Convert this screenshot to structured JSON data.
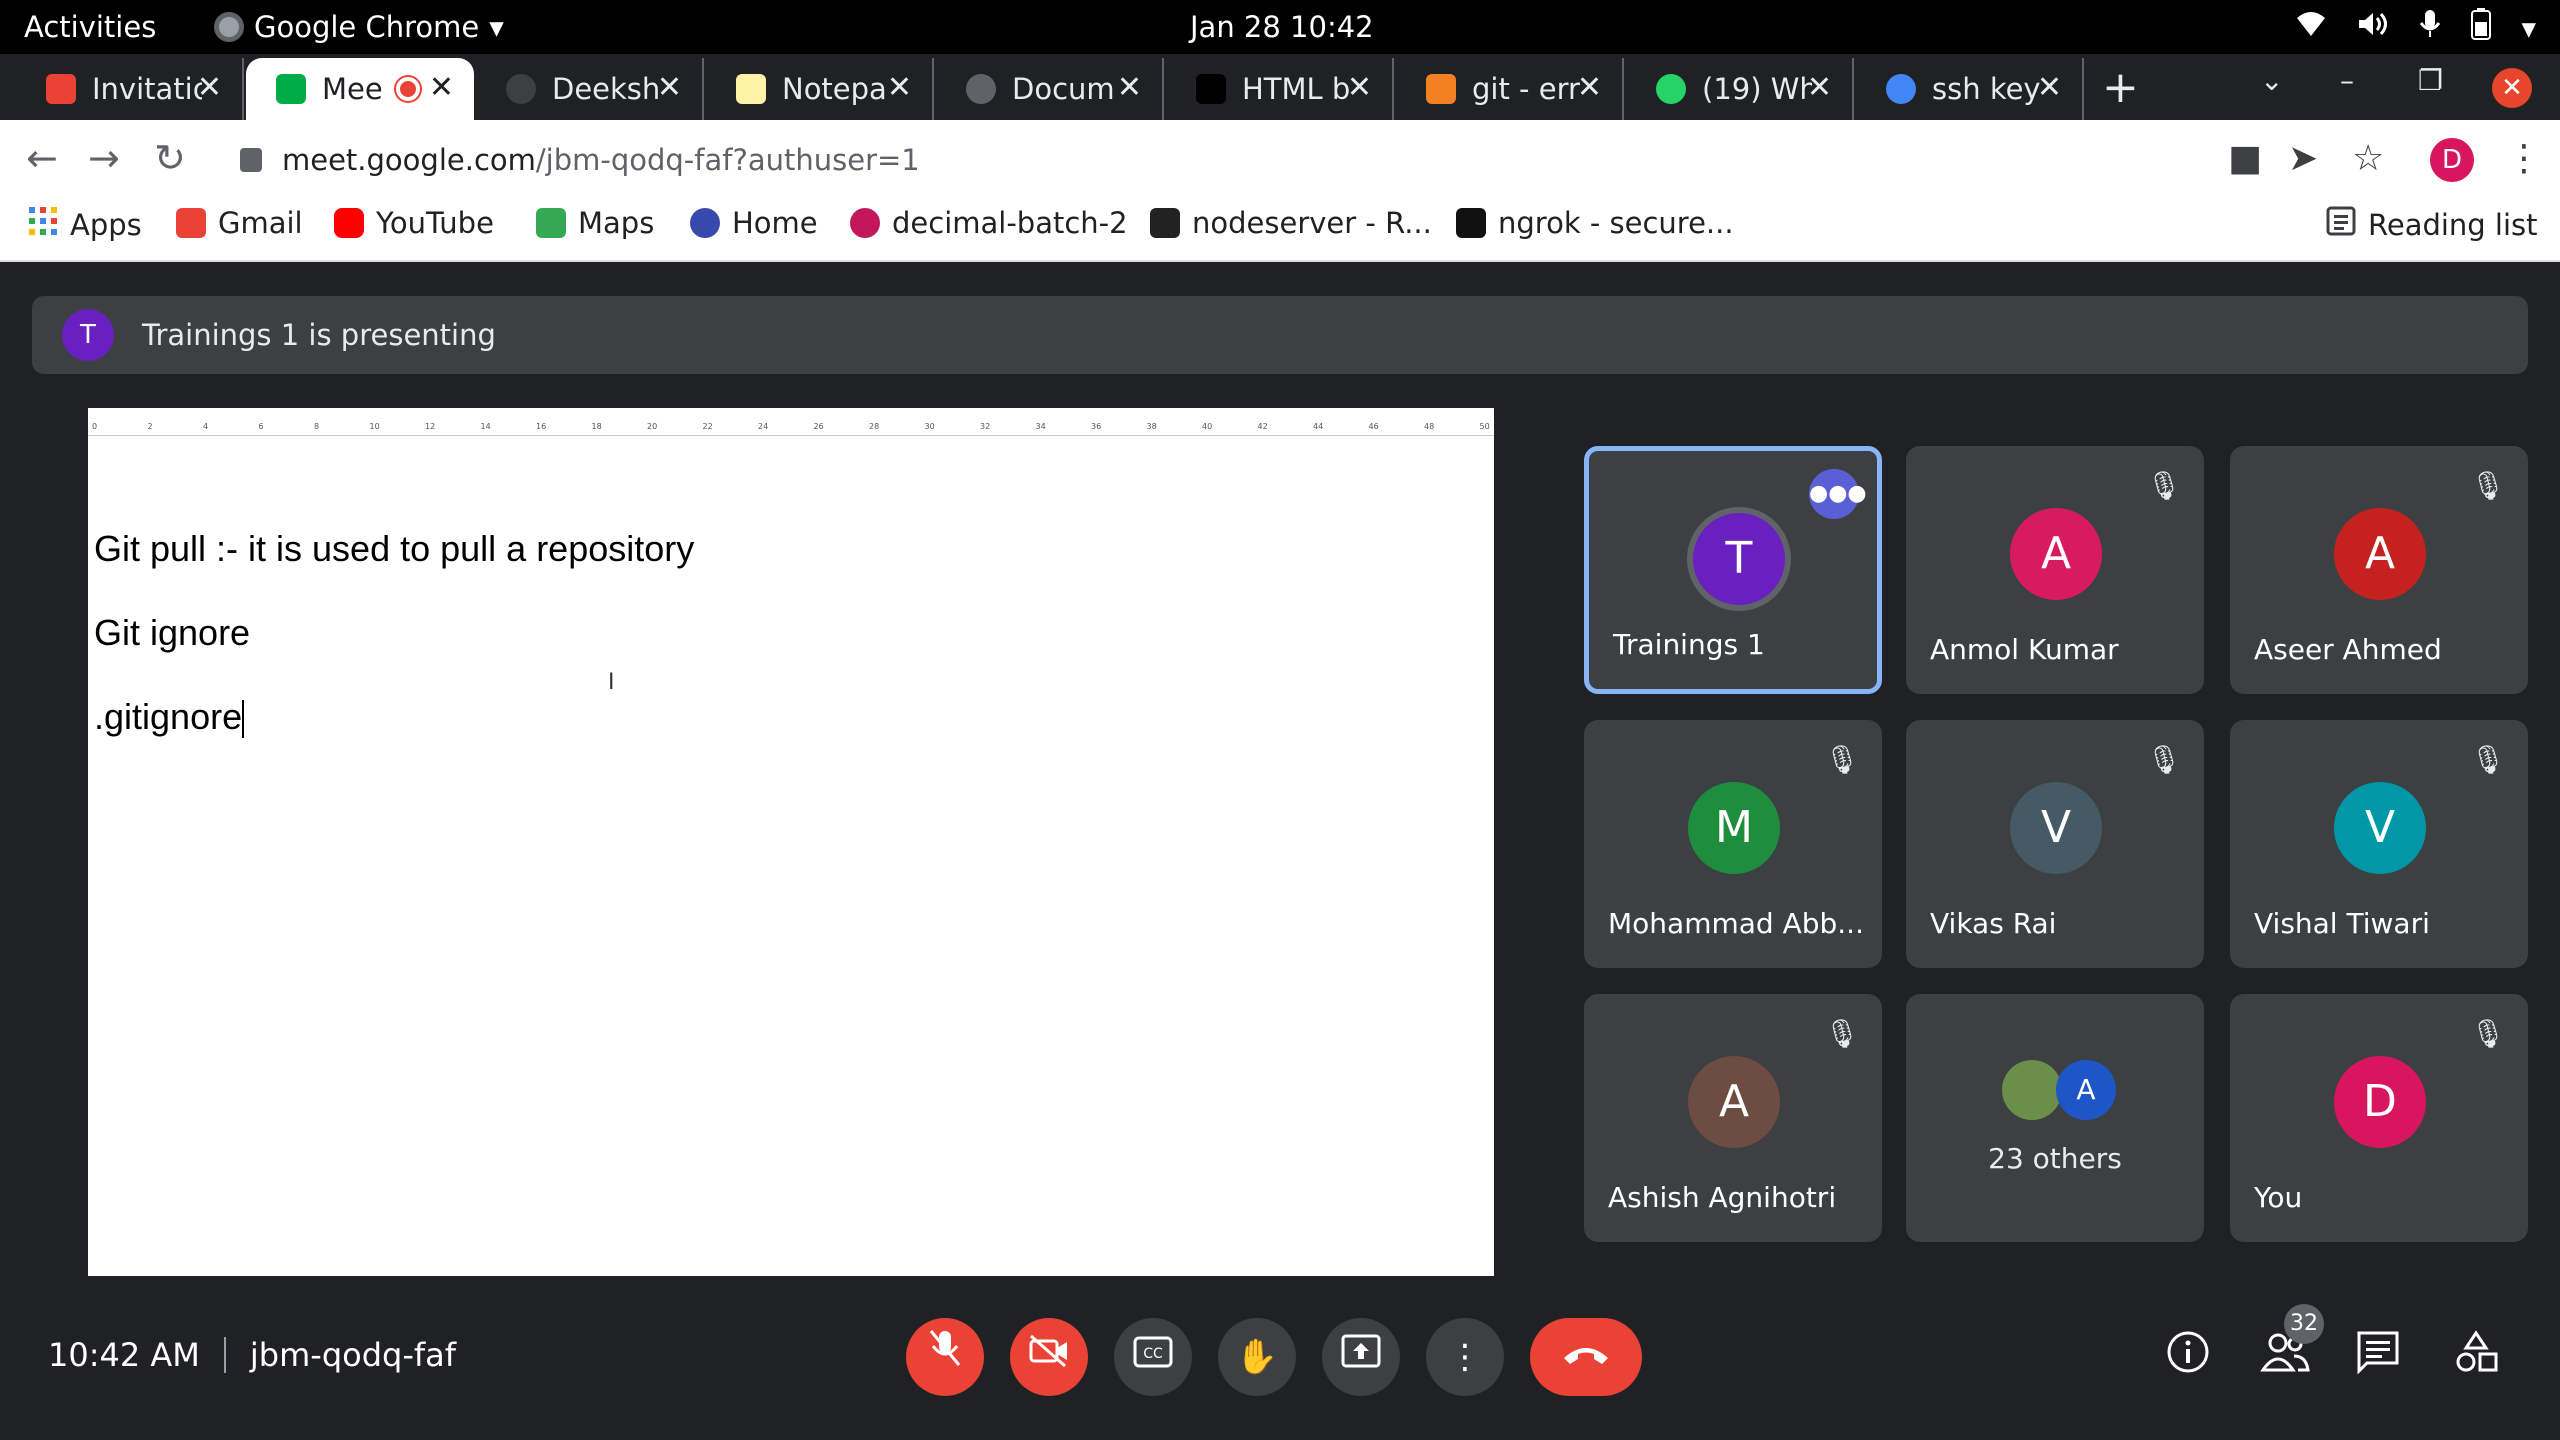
{
  "system": {
    "activities": "Activities",
    "app_name": "Google Chrome",
    "clock": "Jan 28  10:42"
  },
  "tabs": [
    {
      "label": "Invitatio",
      "icon_color": "#ea4335",
      "icon": "gmail-icon"
    },
    {
      "label": "Mee",
      "icon_color": "#00ac47",
      "icon": "meet-icon",
      "active": true
    },
    {
      "label": "Deeksh",
      "icon_color": "#3c4043",
      "icon": "github-icon"
    },
    {
      "label": "Notepa",
      "icon_color": "#fff3a8",
      "icon": "notepad-icon"
    },
    {
      "label": "Docum",
      "icon_color": "#5f6368",
      "icon": "globe-icon"
    },
    {
      "label": "HTML b",
      "icon_color": "#000000",
      "icon": "html-icon"
    },
    {
      "label": "git - err",
      "icon_color": "#f48024",
      "icon": "stackoverflow-icon"
    },
    {
      "label": "(19) Wh",
      "icon_color": "#25d366",
      "icon": "whatsapp-icon"
    },
    {
      "label": "ssh key",
      "icon_color": "#4285f4",
      "icon": "google-icon"
    }
  ],
  "address": {
    "host": "meet.google.com",
    "path": "/jbm-qodq-faf?authuser=1"
  },
  "profile_initial": "D",
  "bookmarks": [
    {
      "label": "Apps",
      "icon_color": "#4285f4"
    },
    {
      "label": "Gmail",
      "icon_color": "#ea4335"
    },
    {
      "label": "YouTube",
      "icon_color": "#ff0000"
    },
    {
      "label": "Maps",
      "icon_color": "#34a853"
    },
    {
      "label": "Home",
      "icon_color": "#3949ab"
    },
    {
      "label": "decimal-batch-2",
      "icon_color": "#c2185b"
    },
    {
      "label": "nodeserver - R...",
      "icon_color": "#222222"
    },
    {
      "label": "ngrok - secure...",
      "icon_color": "#111111"
    }
  ],
  "reading_list": "Reading list",
  "presenting": {
    "initial": "T",
    "text": "Trainings 1 is presenting"
  },
  "document": {
    "lines": [
      "Git pull :- it is used to pull a repository",
      "Git ignore",
      ".gitignore"
    ],
    "ruler": [
      "0",
      "2",
      "4",
      "6",
      "8",
      "10",
      "12",
      "14",
      "16",
      "18",
      "20",
      "22",
      "24",
      "26",
      "28",
      "30",
      "32",
      "34",
      "36",
      "38",
      "40",
      "42",
      "44",
      "46",
      "48",
      "50"
    ]
  },
  "participants": [
    {
      "name": "Trainings 1",
      "initial": "T",
      "color": "#6a1fbf",
      "speaking": true
    },
    {
      "name": "Anmol Kumar",
      "initial": "A",
      "color": "#d81b60",
      "muted": true
    },
    {
      "name": "Aseer Ahmed",
      "initial": "A",
      "color": "#c5221f",
      "muted": true
    },
    {
      "name": "Mohammad Abb...",
      "initial": "M",
      "color": "#1e8e3e",
      "muted": true
    },
    {
      "name": "Vikas Rai",
      "initial": "V",
      "color": "#455a64",
      "muted": true
    },
    {
      "name": "Vishal Tiwari",
      "initial": "V",
      "color": "#0097a7",
      "muted": true
    },
    {
      "name": "Ashish Agnihotri",
      "initial": "A",
      "color": "#6d4c41",
      "muted": true
    },
    {
      "name": "You",
      "initial": "D",
      "color": "#d8155f",
      "muted": true
    }
  ],
  "others": {
    "label": "23 others",
    "initial": "A"
  },
  "bottom": {
    "time": "10:42 AM",
    "meeting_code": "jbm-qodq-faf",
    "people_count": "32"
  }
}
